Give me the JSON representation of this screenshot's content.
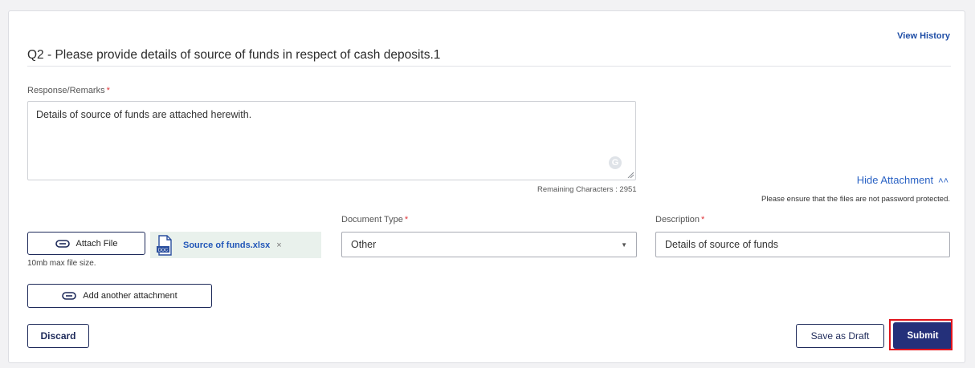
{
  "question": {
    "title": "Q2 - Please provide details of source of funds in respect of cash deposits.1",
    "view_history": "View History"
  },
  "response": {
    "label": "Response/Remarks",
    "required_mark": "*",
    "value": "Details of source of funds are attached herewith.",
    "remaining_characters": "Remaining Characters : 2951"
  },
  "attachment": {
    "hide_label": "Hide Attachment",
    "password_note": "Please ensure that the files are not password protected.",
    "attach_file_label": "Attach File",
    "max_size_note": "10mb max file size.",
    "file": {
      "name": "Source of funds.xlsx",
      "remove": "×",
      "icon_text": "DOC"
    },
    "add_another_label": "Add another attachment"
  },
  "document_type": {
    "label": "Document Type",
    "required_mark": "*",
    "selected": "Other"
  },
  "description": {
    "label": "Description",
    "required_mark": "*",
    "value": "Details of source of funds"
  },
  "actions": {
    "discard": "Discard",
    "save_draft": "Save as Draft",
    "submit": "Submit"
  },
  "colors": {
    "primary": "#24307a",
    "link": "#1f4ea6",
    "required": "#e0363a",
    "highlight": "#e0141c",
    "file_chip_bg": "#e9f1ec"
  }
}
